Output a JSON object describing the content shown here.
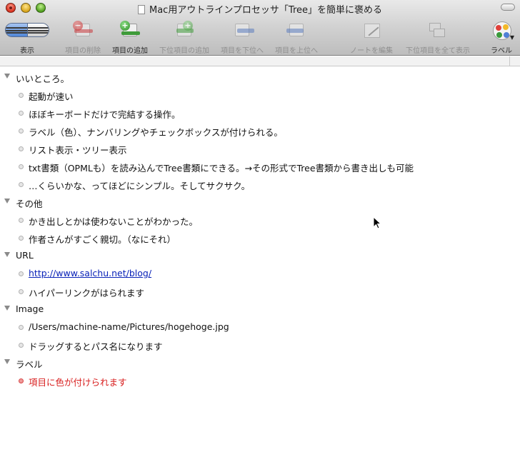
{
  "window": {
    "title": "Mac用アウトラインプロセッサ「Tree」を簡単に褒める"
  },
  "toolbar": {
    "items": [
      {
        "label": "表示",
        "icon": "view-toggle-icon",
        "enabled": true
      },
      {
        "label": "項目の削除",
        "icon": "delete-item-icon",
        "enabled": false
      },
      {
        "label": "項目の追加",
        "icon": "add-item-icon",
        "enabled": true
      },
      {
        "label": "下位項目の追加",
        "icon": "add-subitem-icon",
        "enabled": false
      },
      {
        "label": "項目を下位へ",
        "icon": "indent-icon",
        "enabled": false
      },
      {
        "label": "項目を上位へ",
        "icon": "outdent-icon",
        "enabled": false
      },
      {
        "label": "ノートを編集",
        "icon": "edit-note-icon",
        "enabled": false
      },
      {
        "label": "下位項目を全て表示",
        "icon": "expand-all-icon",
        "enabled": false
      },
      {
        "label": "ラベル",
        "icon": "label-palette-icon",
        "enabled": true
      }
    ]
  },
  "outline": [
    {
      "level": 0,
      "text": "いいところ。"
    },
    {
      "level": 1,
      "text": "起動が速い"
    },
    {
      "level": 1,
      "text": "ほぼキーボードだけで完結する操作。"
    },
    {
      "level": 1,
      "text": "ラベル（色）、ナンバリングやチェックボックスが付けられる。"
    },
    {
      "level": 1,
      "text": "リスト表示・ツリー表示"
    },
    {
      "level": 1,
      "text": "txt書類（OPMLも）を読み込んでTree書類にできる。→その形式でTree書類から書き出しも可能"
    },
    {
      "level": 1,
      "text": "…くらいかな、ってほどにシンプル。そしてサクサク。"
    },
    {
      "level": 0,
      "text": "その他"
    },
    {
      "level": 1,
      "text": "かき出しとかは使わないことがわかった。"
    },
    {
      "level": 1,
      "text": "作者さんがすごく親切。（なにそれ）"
    },
    {
      "level": 0,
      "text": "URL"
    },
    {
      "level": 1,
      "text": "http://www.salchu.net/blog/",
      "style": "link"
    },
    {
      "level": 1,
      "text": "ハイパーリンクがはられます"
    },
    {
      "level": 0,
      "text": "Image"
    },
    {
      "level": 1,
      "text": "/Users/machine-name/Pictures/hogehoge.jpg"
    },
    {
      "level": 1,
      "text": "ドラッグするとパス名になります"
    },
    {
      "level": 0,
      "text": "ラベル"
    },
    {
      "level": 1,
      "text": "項目に色が付けられます",
      "style": "red",
      "label_color": "#d81e1e"
    }
  ],
  "colors": {
    "link": "#0a23b8",
    "label_red": "#d81e1e"
  }
}
